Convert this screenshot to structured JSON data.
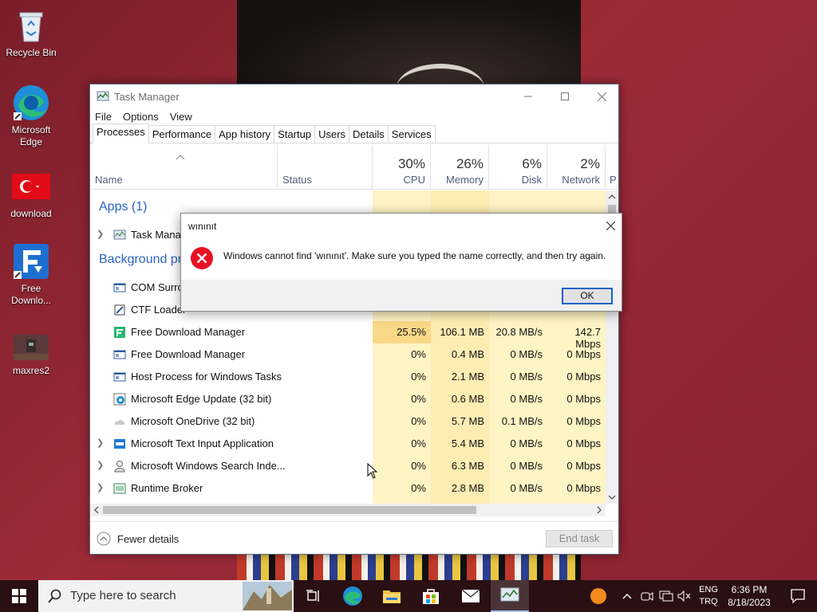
{
  "desktop": {
    "icons": [
      {
        "label": "Recycle Bin"
      },
      {
        "label": "Microsoft Edge"
      },
      {
        "label": "download"
      },
      {
        "label": "Free Downlo..."
      },
      {
        "label": "maxres2"
      }
    ]
  },
  "task_manager": {
    "title": "Task Manager",
    "menu": [
      "File",
      "Options",
      "View"
    ],
    "tabs": [
      "Processes",
      "Performance",
      "App history",
      "Startup",
      "Users",
      "Details",
      "Services"
    ],
    "columns": {
      "name": "Name",
      "status": "Status",
      "cpu": {
        "pct": "30%",
        "label": "CPU"
      },
      "memory": {
        "pct": "26%",
        "label": "Memory"
      },
      "disk": {
        "pct": "6%",
        "label": "Disk"
      },
      "network": {
        "pct": "2%",
        "label": "Network"
      },
      "power_partial": "P"
    },
    "sections": {
      "apps": "Apps (1)",
      "background": "Background pr"
    },
    "app_rows": [
      {
        "name": "Task Manag"
      }
    ],
    "bg_rows_partial": [
      {
        "name": "COM Surrog"
      },
      {
        "name": "CTF Loader"
      }
    ],
    "rows": [
      {
        "name": "Free Download Manager",
        "cpu": "25.5%",
        "memory": "106.1 MB",
        "disk": "20.8 MB/s",
        "network": "142.7 Mbps"
      },
      {
        "name": "Free Download Manager",
        "cpu": "0%",
        "memory": "0.4 MB",
        "disk": "0 MB/s",
        "network": "0 Mbps"
      },
      {
        "name": "Host Process for Windows Tasks",
        "cpu": "0%",
        "memory": "2.1 MB",
        "disk": "0 MB/s",
        "network": "0 Mbps"
      },
      {
        "name": "Microsoft Edge Update (32 bit)",
        "cpu": "0%",
        "memory": "0.6 MB",
        "disk": "0 MB/s",
        "network": "0 Mbps"
      },
      {
        "name": "Microsoft OneDrive (32 bit)",
        "cpu": "0%",
        "memory": "5.7 MB",
        "disk": "0.1 MB/s",
        "network": "0 Mbps"
      },
      {
        "name": "Microsoft Text Input Application",
        "cpu": "0%",
        "memory": "5.4 MB",
        "disk": "0 MB/s",
        "network": "0 Mbps"
      },
      {
        "name": "Microsoft Windows Search Inde...",
        "cpu": "0%",
        "memory": "6.3 MB",
        "disk": "0 MB/s",
        "network": "0 Mbps"
      },
      {
        "name": "Runtime Broker",
        "cpu": "0%",
        "memory": "2.8 MB",
        "disk": "0 MB/s",
        "network": "0 Mbps"
      }
    ],
    "footer": {
      "fewer_details": "Fewer details",
      "end_task": "End task"
    }
  },
  "dialog": {
    "title": "wınınıt",
    "message": "Windows cannot find 'wınınıt'. Make sure you typed the name correctly, and then try again.",
    "ok": "OK"
  },
  "taskbar": {
    "search_placeholder": "Type here to search",
    "lang_top": "ENG",
    "lang_bottom": "TRQ",
    "time": "6:36 PM",
    "date": "8/18/2023"
  },
  "colors": {
    "cpu_high": "#f9d887",
    "cell_light": "#fff4c4",
    "cell_mid": "#feedb3",
    "accent_blue": "#2a63c0",
    "error_red": "#e81123"
  }
}
